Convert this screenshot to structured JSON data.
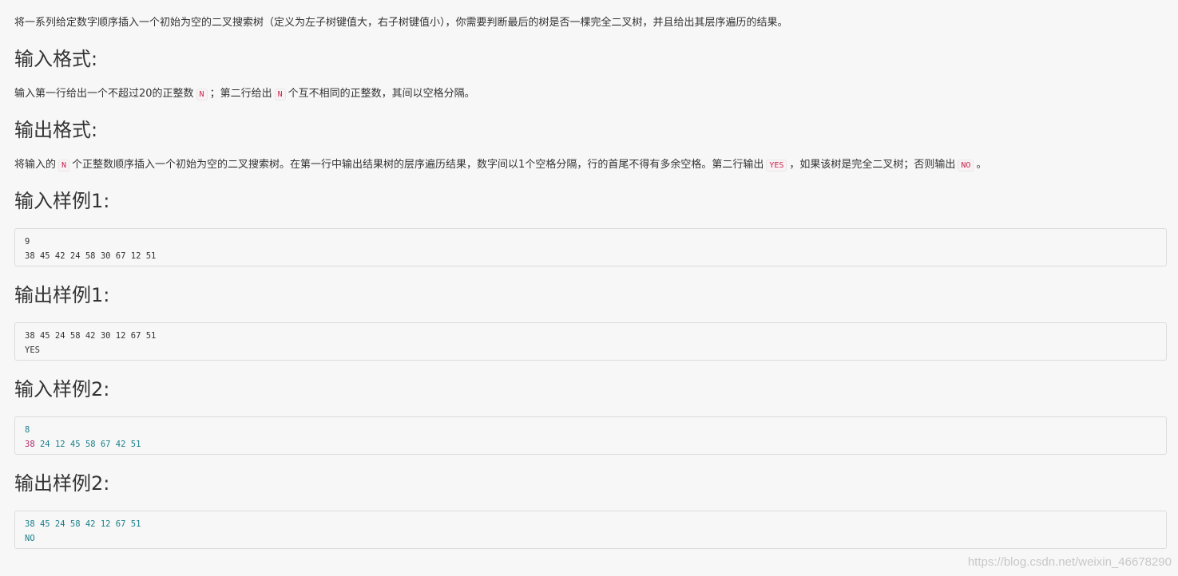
{
  "intro": {
    "text": "将一系列给定数字顺序插入一个初始为空的二叉搜索树（定义为左子树键值大，右子树键值小），你需要判断最后的树是否一棵完全二叉树，并且给出其层序遍历的结果。"
  },
  "input_format": {
    "heading": "输入格式:",
    "part1": "输入第一行给出一个不超过20的正整数",
    "code1": "N",
    "part2": "；第二行给出",
    "code2": "N",
    "part3": "个互不相同的正整数，其间以空格分隔。"
  },
  "output_format": {
    "heading": "输出格式:",
    "part1": "将输入的",
    "code1": "N",
    "part2": "个正整数顺序插入一个初始为空的二叉搜索树。在第一行中输出结果树的层序遍历结果，数字间以1个空格分隔，行的首尾不得有多余空格。第二行输出",
    "code2": "YES",
    "part3": "，如果该树是完全二叉树；否则输出",
    "code3": "NO",
    "part4": "。"
  },
  "sample_input_1": {
    "heading": "输入样例1:",
    "line1": "9",
    "line2": "38 45 42 24 58 30 67 12 51"
  },
  "sample_output_1": {
    "heading": "输出样例1:",
    "line1": "38 45 24 58 42 30 12 67 51",
    "line2": "YES"
  },
  "sample_input_2": {
    "heading": "输入样例2:",
    "line1": "8",
    "line2_first": "38",
    "line2_rest": " 24 12 45 58 67 42 51"
  },
  "sample_output_2": {
    "heading": "输出样例2:",
    "line1": "38 45 24 58 42 12 67 51",
    "line2": "NO"
  },
  "watermark": "https://blog.csdn.net/weixin_46678290",
  "colors": {
    "inline_code": "#c7254e",
    "highlight_teal": "#1a7f8a",
    "highlight_magenta": "#b02a6a"
  }
}
